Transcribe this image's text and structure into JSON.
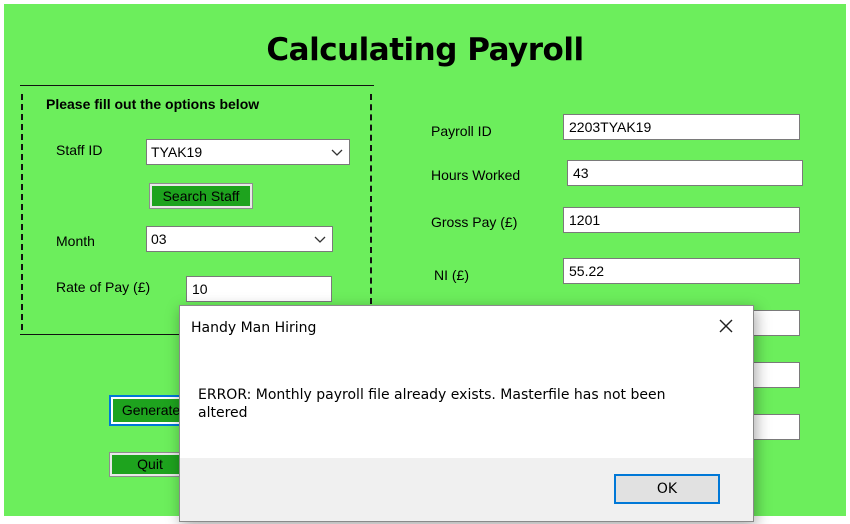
{
  "form": {
    "title": "Calculating Payroll",
    "group_title": "Please fill out the options below",
    "staff_id": {
      "label": "Staff ID",
      "value": "TYAK19"
    },
    "search_button": "Search Staff",
    "month": {
      "label": "Month",
      "value": "03"
    },
    "rate_of_pay": {
      "label": "Rate of Pay (£)",
      "value": "10"
    },
    "generate_button": "Generate",
    "quit_button": "Quit",
    "payroll_id": {
      "label": "Payroll ID",
      "value": "2203TYAK19"
    },
    "hours_worked": {
      "label": "Hours Worked",
      "value": "43"
    },
    "gross_pay": {
      "label": "Gross Pay (£)",
      "value": "1201"
    },
    "ni": {
      "label": "NI (£)",
      "value": "55.22"
    },
    "extra_fields": [
      "",
      "",
      ""
    ]
  },
  "dialog": {
    "title": "Handy Man Hiring",
    "message": "ERROR: Monthly payroll file already exists. Masterfile has not been altered",
    "ok_label": "OK",
    "close_icon": "close-icon"
  },
  "colors": {
    "form_background": "#6cee5c",
    "button_green": "#1ea31e",
    "focus_blue": "#0078d7"
  }
}
